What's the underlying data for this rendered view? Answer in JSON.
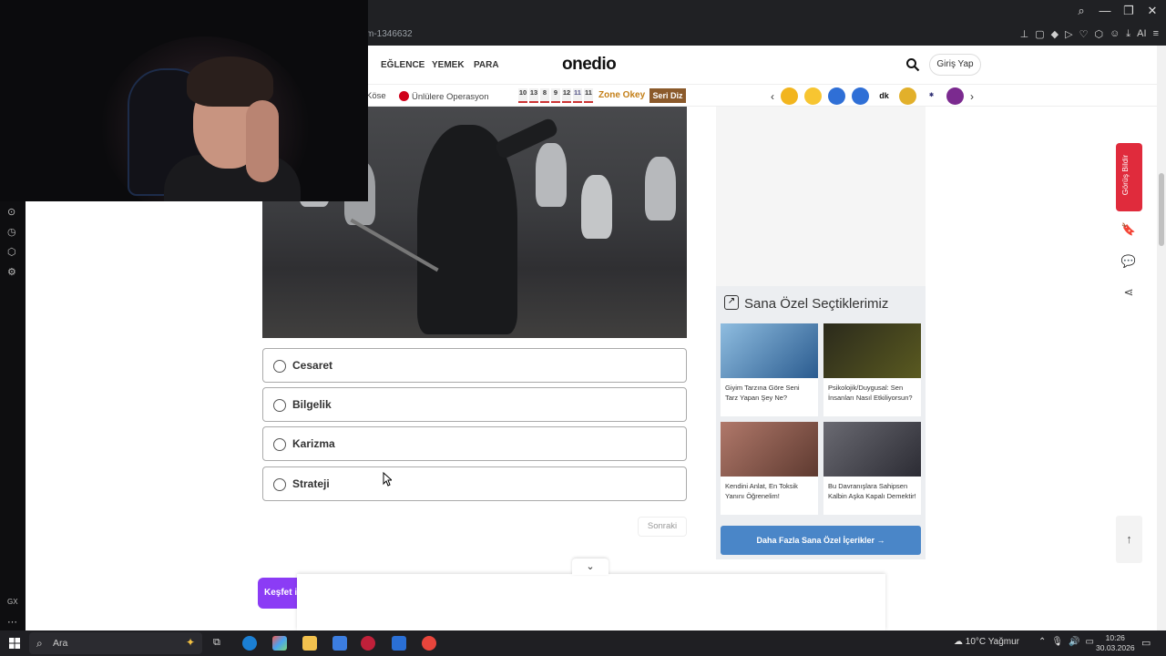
{
  "browser": {
    "url": "m-1346632",
    "window_controls": [
      "⌕",
      "—",
      "❐",
      "✕"
    ],
    "ai_label": "AI"
  },
  "site": {
    "nav": [
      "EĞLENCE",
      "YEMEK",
      "PARA"
    ],
    "logo": "onedio",
    "login": "Giriş Yap"
  },
  "subnav": {
    "kose": "Köse",
    "topic": "Ünlülere Operasyon",
    "calendar": [
      "10",
      "13",
      "8",
      "9",
      "12",
      "11",
      "11"
    ],
    "zone": "Zone Okey",
    "seri": "Seri Diz",
    "emoji_labels": [
      "",
      "",
      "",
      "",
      "dk",
      "",
      "",
      ""
    ]
  },
  "quiz": {
    "options": [
      "Cesaret",
      "Bilgelik",
      "Karizma",
      "Strateji"
    ],
    "next": "Sonraki"
  },
  "picks": {
    "title": "Sana Özel Seçtiklerimiz",
    "cards": [
      {
        "title": "Giyim Tarzına Göre Seni Tarz Yapan Şey Ne?",
        "color": "#6aa0c8"
      },
      {
        "title": "Psikolojik/Duygusal: Sen İnsanları Nasıl Etkiliyorsun?",
        "color": "#3b3a2a"
      },
      {
        "title": "Kendini Anlat, En Toksik Yanını Öğrenelim!",
        "color": "#8a5a4a"
      },
      {
        "title": "Bu Davranışlara Sahipsen Kalbin Aşka Kapalı Demektir!",
        "color": "#4a4a52"
      }
    ],
    "more": "Daha Fazla Sana Özel İçerikler  →"
  },
  "side": {
    "feedback": "Görüş Bildir"
  },
  "kesfet": "Keşfet i",
  "taskbar": {
    "search": "Ara",
    "weather": "10°C  Yağmur",
    "time": "10:26",
    "date": "30.03.2026"
  },
  "left_strip": {
    "gx": "GX"
  }
}
